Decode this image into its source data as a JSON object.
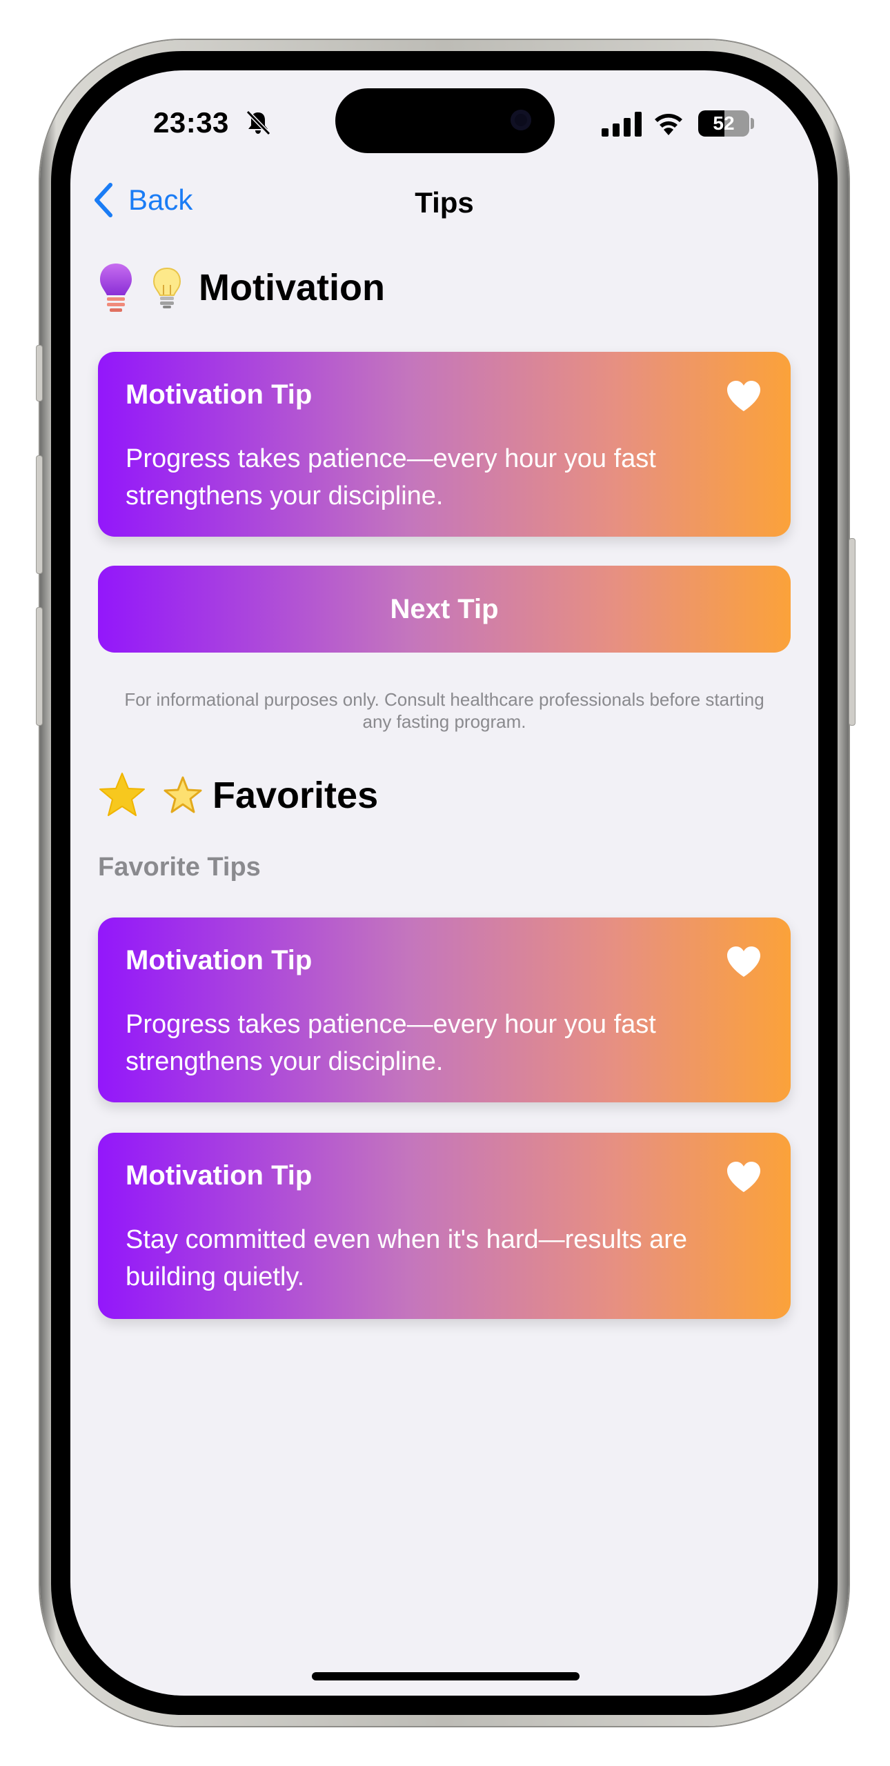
{
  "status_bar": {
    "time": "23:33",
    "battery_level": "52",
    "icons": [
      "bell-slash-icon",
      "cellular-signal-icon",
      "wifi-icon",
      "battery-icon"
    ]
  },
  "nav": {
    "back_label": "Back",
    "title": "Tips"
  },
  "motivation": {
    "heading": "Motivation",
    "icons": [
      "lightbulb-purple-icon",
      "lightbulb-emoji-icon"
    ],
    "current_tip": {
      "category": "Motivation Tip",
      "text": "Progress takes patience—every hour you fast strengthens your discipline."
    },
    "next_button": "Next Tip",
    "disclaimer": "For informational purposes only. Consult healthcare professionals before starting any fasting program."
  },
  "favorites": {
    "heading": "Favorites",
    "icons": [
      "star-filled-icon",
      "star-emoji-icon"
    ],
    "subtitle": "Favorite Tips",
    "items": [
      {
        "category": "Motivation Tip",
        "text": "Progress takes patience—every hour you fast strengthens your discipline."
      },
      {
        "category": "Motivation Tip",
        "text": "Stay committed even when it's hard—results are building quietly."
      }
    ]
  },
  "colors": {
    "accent_blue": "#1a7cf5",
    "gradient_start": "#9317fb",
    "gradient_end": "#fba23a",
    "background": "#f2f1f6"
  }
}
